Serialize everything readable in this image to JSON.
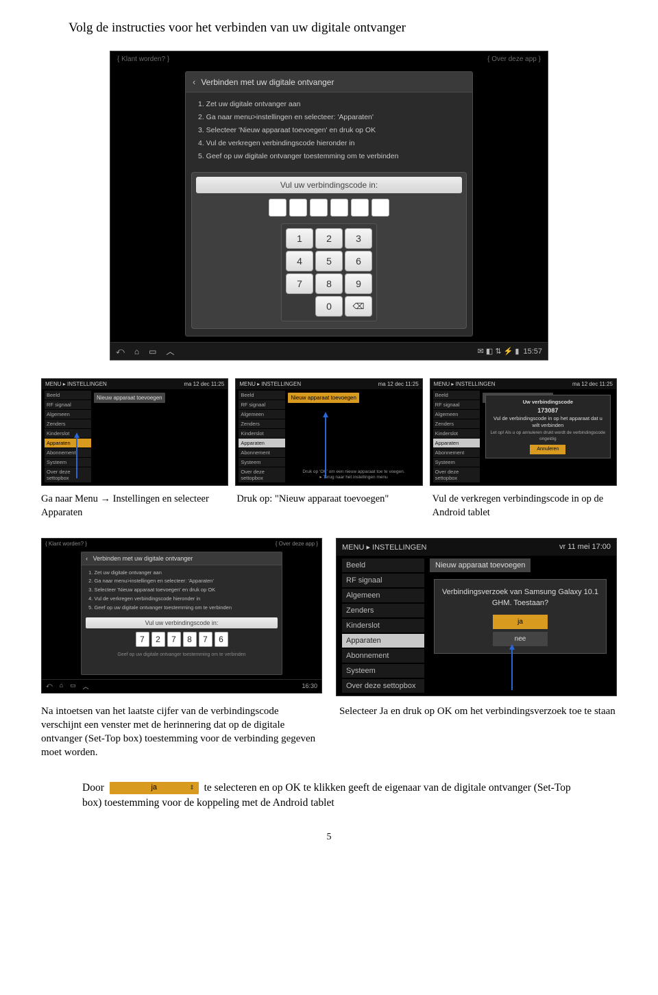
{
  "title": "Volg de instructies voor het verbinden van uw digitale ontvanger",
  "page_number": "5",
  "tablet": {
    "topbar_left": "{ Klant worden? }",
    "topbar_right": "{ Over deze app }",
    "dialog_title": "Verbinden met uw digitale ontvanger",
    "steps": [
      "1. Zet uw digitale ontvanger aan",
      "2. Ga naar menu>instellingen en selecteer: 'Apparaten'",
      "3. Selecteer 'Nieuw apparaat toevoegen' en druk op OK",
      "4. Vul de verkregen verbindingscode hieronder in",
      "5. Geef op uw digitale ontvanger toestemming om te verbinden"
    ],
    "code_label": "Vul uw verbindingscode in:",
    "keys": [
      "1",
      "2",
      "3",
      "4",
      "5",
      "6",
      "7",
      "8",
      "9",
      "",
      "0",
      "⌫"
    ],
    "nav_time": "15:57",
    "nav_status_icons": "✉ ◧ ⇅   ⚡ ▮"
  },
  "stb_row": {
    "top_left": "MENU ▸ INSTELLINGEN",
    "top_right": "ma 12 dec 11:25",
    "menu_items": [
      "Beeld",
      "RF signaal",
      "Algemeen",
      "Zenders",
      "Kinderslot",
      "Apparaten",
      "Abonnement",
      "Systeem",
      "Over deze settopbox"
    ],
    "action_label": "Nieuw apparaat toevoegen",
    "popup_title": "Uw verbindingscode",
    "popup_code": "173087",
    "popup_text": "Vul de verbindingscode in op het apparaat dat u wilt verbinden",
    "popup_note": "Let op! Als u op annuleren drukt wordt de verbindingscode ongeldig",
    "popup_btn": "Annuleren",
    "footer2_line1": "Druk op 'OK' om een nieuw apparaat toe te voegen.",
    "footer2_line2": "▸ Terug naar het instellingen menu"
  },
  "caption_row": {
    "c1": "Ga naar Menu → Instellingen en selecteer Apparaten",
    "c2": "Druk op: \"Nieuw apparaat toevoegen\"",
    "c3": "Vul de verkregen verbindingscode in op de Android tablet"
  },
  "tablet_small": {
    "topbar_left": "{ Klant worden? }",
    "topbar_right": "{ Over deze app }",
    "dialog_title": "Verbinden met uw digitale ontvanger",
    "steps": [
      "1. Zet uw digitale ontvanger aan",
      "2. Ga naar menu>instellingen en selecteer: 'Apparaten'",
      "3. Selecteer 'Nieuw apparaat toevoegen' en druk op OK",
      "4. Vul de verkregen verbindingscode hieronder in",
      "5. Geef op uw digitale ontvanger toestemming om te verbinden"
    ],
    "code_label": "Vul uw verbindingscode in:",
    "code_digits": [
      "7",
      "2",
      "7",
      "8",
      "7",
      "6"
    ],
    "hint": "Geef op uw digitale ontvanger toestemming om te verbinden",
    "nav_time": "16:30"
  },
  "stb_large": {
    "top_left": "MENU ▸ INSTELLINGEN",
    "top_right": "vr 11 mei 17:00",
    "menu_items": [
      "Beeld",
      "RF signaal",
      "Algemeen",
      "Zenders",
      "Kinderslot",
      "Apparaten",
      "Abonnement",
      "Systeem",
      "Over deze settopbox"
    ],
    "action_label": "Nieuw apparaat toevoegen",
    "popup_text": "Verbindingsverzoek van Samsung Galaxy 10.1 GHM. Toestaan?",
    "btn_yes": "ja",
    "btn_no": "nee"
  },
  "caption_pair": {
    "left": "Na intoetsen van het laatste cijfer van de verbindingscode verschijnt een venster met de herinnering dat op de digitale ontvanger (Set-Top box) toestemming voor de verbinding gegeven moet worden.",
    "right": "Selecteer Ja en druk op OK om het verbindingsverzoek toe te staan"
  },
  "final": {
    "prefix": "Door",
    "ja_label": "ja",
    "rest": "te selecteren en op OK te klikken geeft de eigenaar van de digitale ontvanger (Set-Top box) toestemming voor de koppeling met de Android tablet"
  }
}
